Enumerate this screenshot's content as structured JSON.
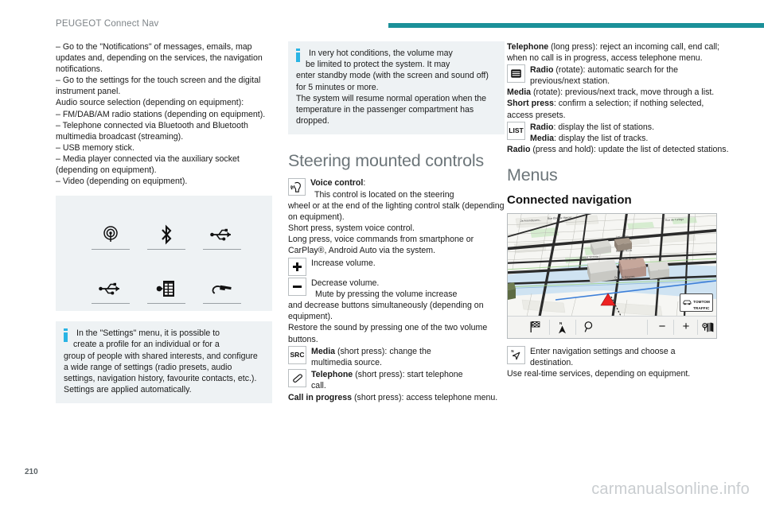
{
  "header": {
    "title": "PEUGEOT Connect Nav",
    "rule_color": "#1b9099"
  },
  "column1": {
    "paragraphs": [
      "–  Go to the \"Notifications\" of messages, emails, map updates and, depending on the services, the navigation notifications.",
      "–  Go to the settings for the touch screen and the digital instrument panel.",
      "Audio source selection (depending on equipment):",
      "–  FM/DAB/AM radio stations (depending on equipment).",
      "–  Telephone connected via Bluetooth and Bluetooth multimedia broadcast (streaming).",
      "–  USB memory stick.",
      "–  Media player connected via the auxiliary socket (depending on equipment).",
      "–  Video (depending on equipment)."
    ],
    "source_icons": [
      {
        "name": "radio-antenna-icon",
        "label": "Radio"
      },
      {
        "name": "bluetooth-icon",
        "label": "Bluetooth"
      },
      {
        "name": "usb-icon",
        "label": "USB"
      },
      {
        "name": "usb-icon-2",
        "label": "USB"
      },
      {
        "name": "video-film-icon",
        "label": "Video"
      },
      {
        "name": "auxiliary-jack-icon",
        "label": "Auxiliary socket"
      }
    ],
    "info_box": {
      "line1": "In the \"Settings\" menu, it is possible to",
      "line2": "create a profile for an individual or for a",
      "rest": "group of people with shared interests, and configure a wide range of settings (radio presets, audio settings, navigation history, favourite contacts, etc.). Settings are applied automatically."
    }
  },
  "column2": {
    "info_box": {
      "line1": "In very hot conditions, the volume may",
      "line2": "be limited to protect the system. It may",
      "rest": "enter standby mode (with the screen and sound off) for 5 minutes or more.",
      "rest2": "The system will resume normal operation when the temperature in the passenger compartment has dropped."
    },
    "heading": "Steering mounted controls",
    "voice": {
      "icon": "voice-control-icon",
      "title": "Voice control",
      "title_suffix": ":",
      "line": "This control is located on the steering",
      "rest": "wheel or at the end of the lighting control stalk (depending on equipment).",
      "short_press": "Short press, system voice control.",
      "long_press": "Long press, voice commands from smartphone or CarPlay®, Android Auto via the system."
    },
    "volume": {
      "plus_key": "+",
      "plus_text": "Increase volume.",
      "minus_key": "−",
      "minus_text": "Decrease volume.",
      "mute_line": "Mute by pressing the volume increase",
      "mute_rest": "and decrease buttons simultaneously (depending on equipment).",
      "restore": "Restore the sound by pressing one of the two volume buttons."
    },
    "src": {
      "key": "SRC",
      "bold": "Media",
      "text": " (short press): change the",
      "text2": "multimedia source."
    },
    "phone": {
      "key_icon": "telephone-handset-icon",
      "bold": "Telephone",
      "text": " (short press): start telephone",
      "text2": "call."
    },
    "call_in_progress": {
      "bold": "Call in progress",
      "text": " (short press): access telephone menu."
    }
  },
  "column3": {
    "telephone_long": {
      "bold": "Telephone",
      "text": " (long press): reject an incoming call, end call; when no call is in progress, access telephone menu."
    },
    "rotate": {
      "key_icon": "rotary-knob-icon",
      "bold": "Radio",
      "text": " (rotate): automatic search for the",
      "text2": "previous/next station."
    },
    "media_rotate": {
      "bold": "Media",
      "text": " (rotate): previous/next track, move through a list."
    },
    "short_press": {
      "bold": "Short press",
      "text": ": confirm a selection; if nothing selected, access presets."
    },
    "list": {
      "key": "LIST",
      "radio_bold": "Radio",
      "radio_text": ": display the list of stations.",
      "media_bold": "Media",
      "media_text": ": display the list of tracks."
    },
    "radio_hold": {
      "bold": "Radio",
      "text": " (press and hold): update the list of detected stations."
    },
    "menus_heading": "Menus",
    "connected_nav_heading": "Connected navigation",
    "nav_screenshot": {
      "map_labels": [
        "2e Arrondissem...",
        "Rue Étienne Marcel",
        "Rue de Turbigo",
        "Les Halles",
        "Rue de Rivoli",
        "Avenue Victoria",
        "Quai de Gesvres",
        "Hôtel de Ville"
      ],
      "traffic_badge_line1": "TOMTOM",
      "traffic_badge_line2": "TRAFFIC",
      "toolbar_icons": [
        "checkered-flag-icon",
        "north-compass-icon",
        "search-magnifier-icon",
        "zoom-out-icon",
        "zoom-in-icon",
        "map-options-icon"
      ],
      "zoom_out_label": "−",
      "zoom_in_label": "+"
    },
    "nav_settings": {
      "key_icon": "navigation-compass-icon",
      "text": "Enter navigation settings and choose a",
      "text2": "destination."
    },
    "realtime": "Use real-time services, depending on equipment."
  },
  "footer": {
    "page_number": "210",
    "watermark": "carmanualsonline.info"
  }
}
